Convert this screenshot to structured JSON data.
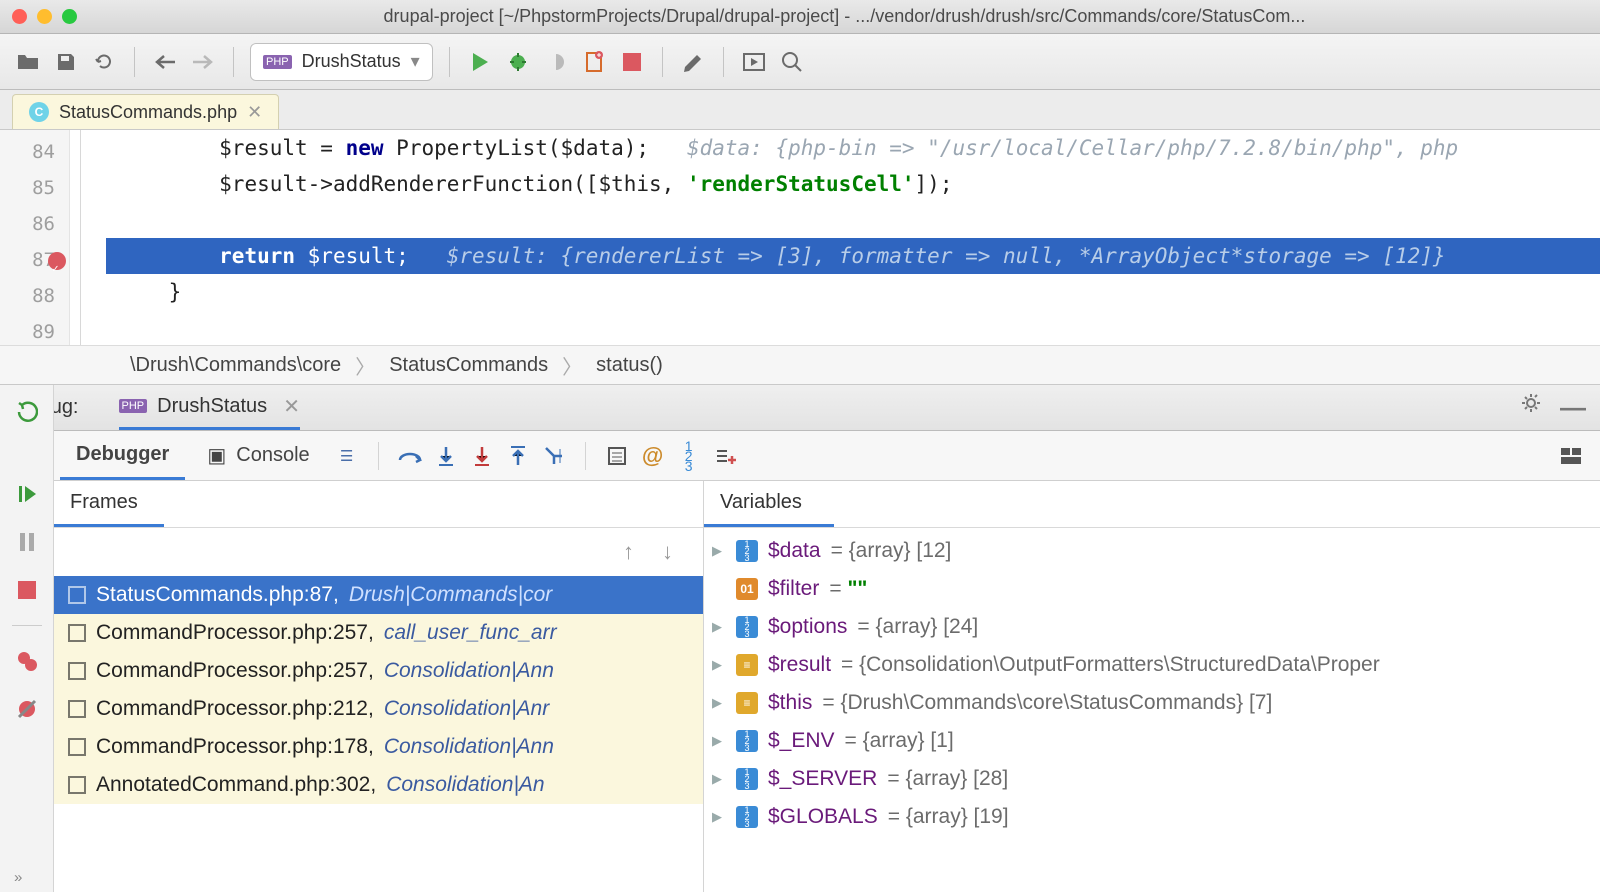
{
  "window": {
    "title": "drupal-project [~/PhpstormProjects/Drupal/drupal-project] - .../vendor/drush/drush/src/Commands/core/StatusCom..."
  },
  "toolbar": {
    "run_config": "DrushStatus"
  },
  "editor": {
    "tab_label": "StatusCommands.php",
    "lines": [
      "84",
      "85",
      "86",
      "87",
      "88",
      "89"
    ],
    "l84_a": "$result = ",
    "l84_kw": "new",
    "l84_b": " PropertyList($data);   ",
    "l84_hint": "$data: {php-bin => \"/usr/local/Cellar/php/7.2.8/bin/php\", php",
    "l85": "$result->addRendererFunction([$this, ",
    "l85_str": "'renderStatusCell'",
    "l85_end": "]);",
    "l87_kw": "return",
    "l87_b": " $result;   ",
    "l87_hint": "$result: {rendererList => [3], formatter => null, *ArrayObject*storage => [12]}",
    "l88": "    }",
    "crumbs": [
      "\\Drush\\Commands\\core",
      "StatusCommands",
      "status()"
    ]
  },
  "debug": {
    "label": "Debug:",
    "config": "DrushStatus",
    "tabs": {
      "debugger": "Debugger",
      "console": "Console"
    },
    "frames_title": "Frames",
    "vars_title": "Variables",
    "frames": [
      {
        "file": "StatusCommands.php:87,",
        "ctx": "Drush|Commands|cor",
        "sel": true
      },
      {
        "file": "CommandProcessor.php:257,",
        "ctx": "call_user_func_arr"
      },
      {
        "file": "CommandProcessor.php:257,",
        "ctx": "Consolidation|Ann"
      },
      {
        "file": "CommandProcessor.php:212,",
        "ctx": "Consolidation|Anr"
      },
      {
        "file": "CommandProcessor.php:178,",
        "ctx": "Consolidation|Ann"
      },
      {
        "file": "AnnotatedCommand.php:302,",
        "ctx": "Consolidation|An"
      }
    ],
    "vars": [
      {
        "ic": "arr",
        "name": "$data",
        "val": " = {array} [12]",
        "tw": true
      },
      {
        "ic": "str",
        "name": "$filter",
        "val": " = ",
        "str": "\"\""
      },
      {
        "ic": "arr",
        "name": "$options",
        "val": " = {array} [24]",
        "tw": true
      },
      {
        "ic": "obj",
        "name": "$result",
        "val": " = {Consolidation\\OutputFormatters\\StructuredData\\Proper",
        "tw": true
      },
      {
        "ic": "obj",
        "name": "$this",
        "val": " = {Drush\\Commands\\core\\StatusCommands} [7]",
        "tw": true
      },
      {
        "ic": "arr",
        "name": "$_ENV",
        "val": " = {array} [1]",
        "tw": true
      },
      {
        "ic": "arr",
        "name": "$_SERVER",
        "val": " = {array} [28]",
        "tw": true
      },
      {
        "ic": "arr",
        "name": "$GLOBALS",
        "val": " = {array} [19]",
        "tw": true
      }
    ]
  }
}
